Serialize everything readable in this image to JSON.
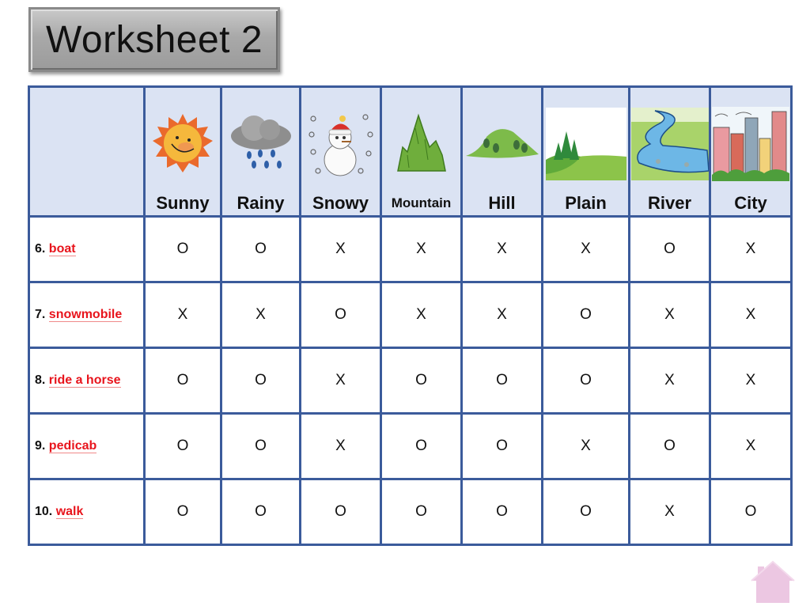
{
  "title": "Worksheet 2",
  "columns": [
    {
      "label": "Sunny",
      "icon": "sun-icon"
    },
    {
      "label": "Rainy",
      "icon": "rain-cloud-icon"
    },
    {
      "label": "Snowy",
      "icon": "snowman-icon"
    },
    {
      "label": "Mountain",
      "icon": "mountain-icon"
    },
    {
      "label": "Hill",
      "icon": "hill-icon"
    },
    {
      "label": "Plain",
      "icon": "plain-icon"
    },
    {
      "label": "River",
      "icon": "river-icon"
    },
    {
      "label": "City",
      "icon": "city-icon"
    }
  ],
  "rows": [
    {
      "number": "6.",
      "activity": "boat",
      "marks": [
        "O",
        "O",
        "X",
        "X",
        "X",
        "X",
        "O",
        "X"
      ]
    },
    {
      "number": "7.",
      "activity": "snowmobile",
      "marks": [
        "X",
        "X",
        "O",
        "X",
        "X",
        "O",
        "X",
        "X"
      ]
    },
    {
      "number": "8.",
      "activity": "ride a horse",
      "marks": [
        "O",
        "O",
        "X",
        "O",
        "O",
        "O",
        "X",
        "X"
      ]
    },
    {
      "number": "9.",
      "activity": "pedicab",
      "marks": [
        "O",
        "O",
        "X",
        "O",
        "O",
        "X",
        "O",
        "X"
      ]
    },
    {
      "number": "10.",
      "activity": "walk",
      "marks": [
        "O",
        "O",
        "O",
        "O",
        "O",
        "O",
        "X",
        "O"
      ]
    }
  ],
  "colors": {
    "border": "#3b5b9b",
    "header_bg": "#dbe3f3",
    "activity_text": "#e8141c"
  },
  "home_button": {
    "icon": "home-icon"
  }
}
